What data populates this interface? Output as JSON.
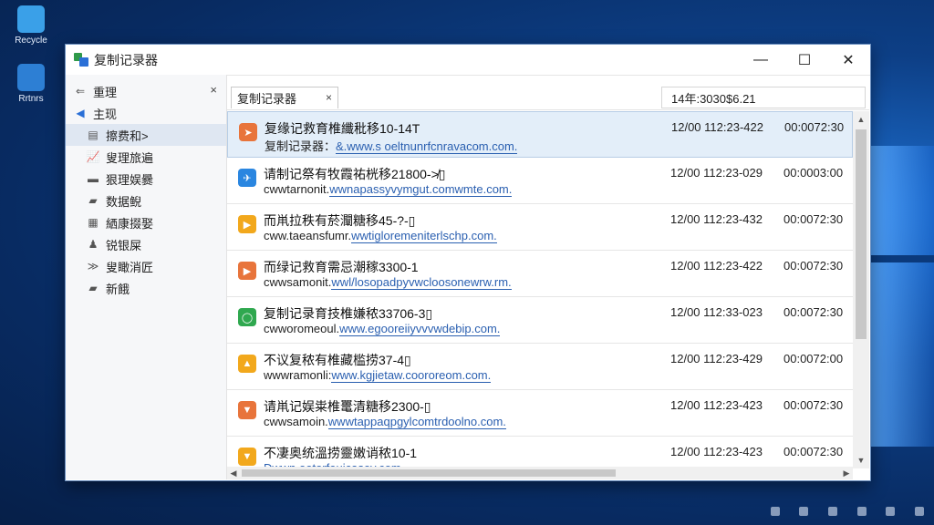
{
  "desktop": {
    "icons": [
      {
        "label": "Recycle",
        "color": "#3aa0e8"
      },
      {
        "label": "Rrtnrs",
        "color": "#2d7fd4"
      }
    ]
  },
  "window": {
    "title": "复制记录器",
    "controls": {
      "minimize": "—",
      "maximize": "☐",
      "close": "✕"
    }
  },
  "sidebar": {
    "header": {
      "label": "重理",
      "close": "×"
    },
    "main": {
      "label": "主现"
    },
    "items": [
      {
        "label": "擦费和>",
        "icon": "clipboard-icon",
        "glyph": "▤"
      },
      {
        "label": "叟理旅遍",
        "icon": "chart-icon",
        "glyph": "📈"
      },
      {
        "label": "狠理娱爨",
        "icon": "message-icon",
        "glyph": "▬"
      },
      {
        "label": "数据鲵",
        "icon": "folder-icon",
        "glyph": "▰"
      },
      {
        "label": "絤康掇娶",
        "icon": "document-icon",
        "glyph": "▦"
      },
      {
        "label": "锐银屎",
        "icon": "user-icon",
        "glyph": "♟"
      },
      {
        "label": "叟瞰消匠",
        "icon": "forward-icon",
        "glyph": "≫"
      },
      {
        "label": "新餓",
        "icon": "folder-icon",
        "glyph": "▰"
      }
    ]
  },
  "tab": {
    "label": "复制记录器",
    "close": "×"
  },
  "timestamp": "14年:3030$6.21",
  "rows": [
    {
      "title": "复缘记救育椎纖秕移10-14T",
      "prefix": "复制记录器：",
      "url": "&.www.s oeltnunrfcnravacom.com.",
      "date": "12/00 112:23-422",
      "num": "00:0072:30",
      "icon_color": "#e8743b",
      "glyph": "➤",
      "selected": true
    },
    {
      "title": "请制记祭有牧霞祐桄移21800-≯▯",
      "prefix": "cwwtarnonit.",
      "url": "wwnapassyvymgut.comwmte.com.",
      "date": "12/00 112:23-029",
      "num": "00:0003:00",
      "icon_color": "#2a86e0",
      "glyph": "✈",
      "selected": false
    },
    {
      "title": "而鼡拉秩有菸灛糖移45-?-▯",
      "prefix": "cww.taeansfumr.",
      "url": "wwtigloremeniterlschp.com.",
      "date": "12/00 112:23-432",
      "num": "00:0072:30",
      "icon_color": "#f2a81c",
      "glyph": "▶",
      "selected": false
    },
    {
      "title": "而绿记救育需忌潮稼3300-1",
      "prefix": "cwwsamonit.",
      "url": "wwl/losopadpyvwcloosonewrw.rm.",
      "date": "12/00 112:23-422",
      "num": "00:0072:30",
      "icon_color": "#e8743b",
      "glyph": "▶",
      "selected": false
    },
    {
      "title": "复制记录育技椎嫌秾33706-3▯",
      "prefix": "cwworomeoul.",
      "url": "www.egooreiiyvvvwdebip.com.",
      "date": "12/00 112:33-023",
      "num": "00:0072:30",
      "icon_color": "#2fa84f",
      "glyph": "◯",
      "selected": false
    },
    {
      "title": "不议复秾有椎藏槛捞37-4▯",
      "prefix": "wwwramonli:",
      "url": "www.kgjietaw.coororeom.com.",
      "date": "12/00 112:23-429",
      "num": "00:0072:00",
      "icon_color": "#f2a81c",
      "glyph": "▲",
      "selected": false
    },
    {
      "title": "请鼡记娱粜椎鼍清糖移2300-▯",
      "prefix": "cwwsamoin.",
      "url": "wwwtappaqpgylcomtrdoolno.com.",
      "date": "12/00 112:23-423",
      "num": "00:0072:30",
      "icon_color": "#e8743b",
      "glyph": "▼",
      "selected": false
    },
    {
      "title": "不凄奥统溫捞靈嫩诮秾10-1",
      "prefix": "",
      "url": "Dwwn.oetorfeuicasev.com",
      "date": "12/00 112:23-423",
      "num": "00:0072:30",
      "icon_color": "#f2a81c",
      "glyph": "▼",
      "selected": false
    }
  ]
}
